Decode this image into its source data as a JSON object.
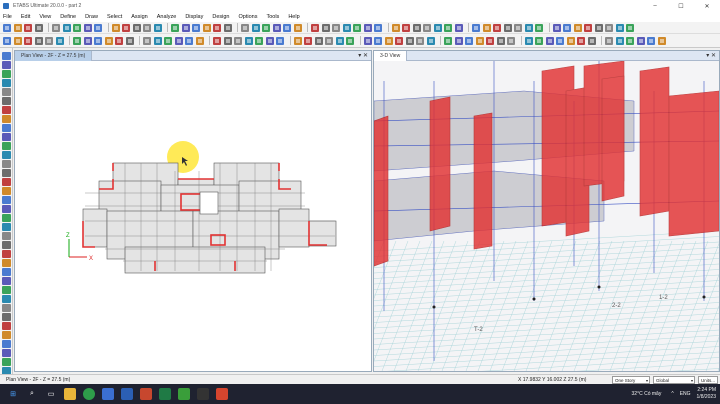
{
  "window": {
    "title": "ETABS Ultimate 20.0.0 - part 2",
    "controls": [
      "–",
      "☐",
      "✕"
    ]
  },
  "menu": [
    "File",
    "Edit",
    "View",
    "Define",
    "Draw",
    "Select",
    "Assign",
    "Analyze",
    "Display",
    "Design",
    "Options",
    "Tools",
    "Help"
  ],
  "plan_view": {
    "tab_label": "Plan View - 2F - Z = 27.5 (m)",
    "axis_x": "X",
    "axis_z": "Z"
  },
  "view_3d": {
    "tab_label": "3-D View",
    "grid_labels": [
      "1-2",
      "2-2",
      "T-2"
    ]
  },
  "status": {
    "left": "Plan View - 2F - Z = 27.5 (m)",
    "coords": "X 17.9832  Y 16.002  Z 27.5 (m)",
    "story": "One Story",
    "coord_sys": "Global",
    "units": "Units..."
  },
  "taskbar": {
    "weather": "32°C  Có mây",
    "lang": "ENG",
    "time": "2:24 PM",
    "date": "1/8/2023"
  },
  "colors": {
    "accent": "#2a6ebd",
    "wall_red": "#e23232",
    "grid_blue": "#3b52c4"
  }
}
